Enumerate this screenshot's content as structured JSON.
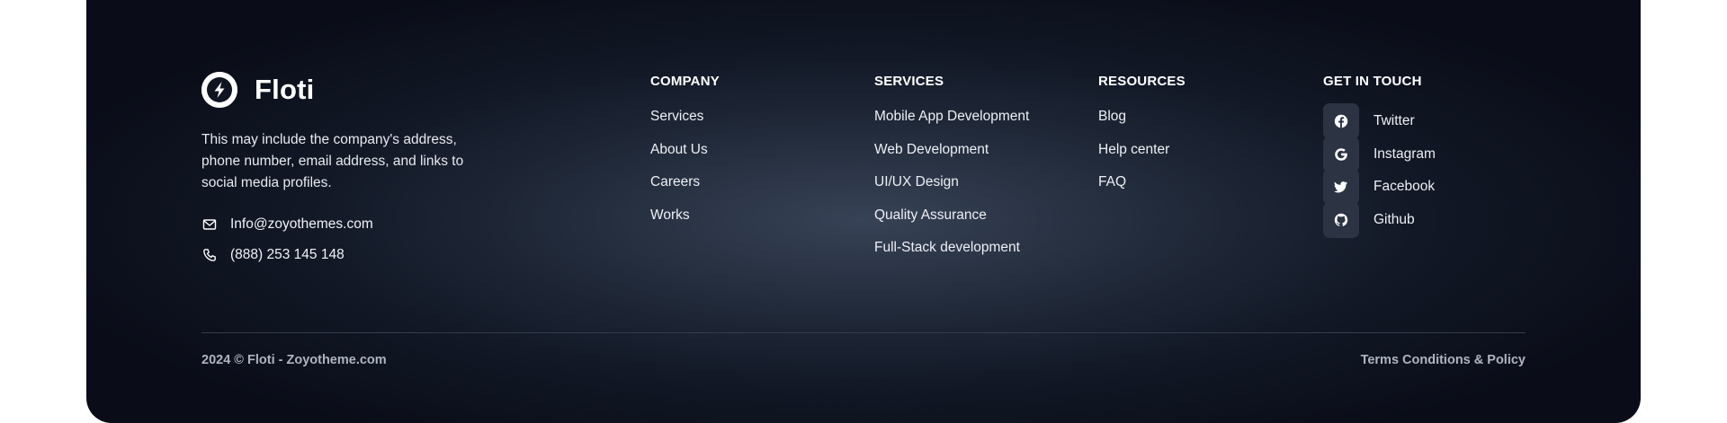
{
  "brand": {
    "name": "Floti",
    "logo_icon": "lightning-bolt-icon",
    "description": "This may include the company's address, phone number, email address, and links to social media profiles."
  },
  "contact": {
    "email": "Info@zoyothemes.com",
    "email_icon": "mail-icon",
    "phone": "(888) 253 145 148",
    "phone_icon": "phone-icon"
  },
  "company": {
    "heading": "COMPANY",
    "links": [
      "Services",
      "About Us",
      "Careers",
      "Works"
    ]
  },
  "services": {
    "heading": "SERVICES",
    "links": [
      "Mobile App Development",
      "Web Development",
      "UI/UX Design",
      "Quality Assurance",
      "Full-Stack development"
    ]
  },
  "resources": {
    "heading": "RESOURCES",
    "links": [
      "Blog",
      "Help center",
      "FAQ"
    ]
  },
  "touch": {
    "heading": "GET IN TOUCH",
    "links": [
      {
        "label": "Twitter",
        "icon": "facebook-icon"
      },
      {
        "label": "Instagram",
        "icon": "google-icon"
      },
      {
        "label": "Facebook",
        "icon": "twitter-icon"
      },
      {
        "label": "Github",
        "icon": "github-icon"
      }
    ]
  },
  "bottom": {
    "copyright": "2024 © Floti - Zoyotheme.com",
    "terms": "Terms Conditions & Policy"
  },
  "colors": {
    "background_center": "#374256",
    "background_edge": "#0a0d18",
    "social_button": "#2c3342",
    "muted_text": "#aeb4c0"
  }
}
